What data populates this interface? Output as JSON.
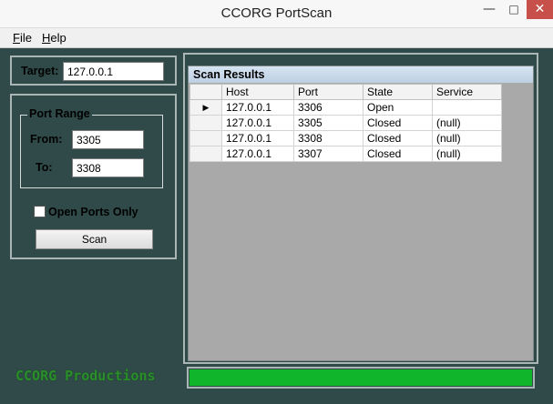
{
  "window": {
    "title": "CCORG PortScan",
    "min_glyph": "—",
    "max_glyph": "□",
    "close_glyph": "✕"
  },
  "menu": {
    "file": "File",
    "help": "Help"
  },
  "target": {
    "label": "Target:",
    "value": "127.0.0.1"
  },
  "port_range": {
    "legend": "Port Range",
    "from_label": "From:",
    "from_value": "3305",
    "to_label": "To:",
    "to_value": "3308"
  },
  "open_ports_only": {
    "label": "Open Ports Only",
    "checked": false
  },
  "scan_button": "Scan",
  "brand": "CCORG Productions",
  "results": {
    "title": "Scan Results",
    "columns": [
      "Host",
      "Port",
      "State",
      "Service"
    ],
    "rows": [
      {
        "host": "127.0.0.1",
        "port": "3306",
        "state": "Open",
        "service": ""
      },
      {
        "host": "127.0.0.1",
        "port": "3305",
        "state": "Closed",
        "service": "(null)"
      },
      {
        "host": "127.0.0.1",
        "port": "3308",
        "state": "Closed",
        "service": "(null)"
      },
      {
        "host": "127.0.0.1",
        "port": "3307",
        "state": "Closed",
        "service": "(null)"
      }
    ],
    "current_row_glyph": "▶"
  },
  "progress": {
    "percent": 100
  },
  "colors": {
    "background": "#2f4a48",
    "progress_fill": "#11b52c",
    "brand": "#2a8f2a"
  }
}
